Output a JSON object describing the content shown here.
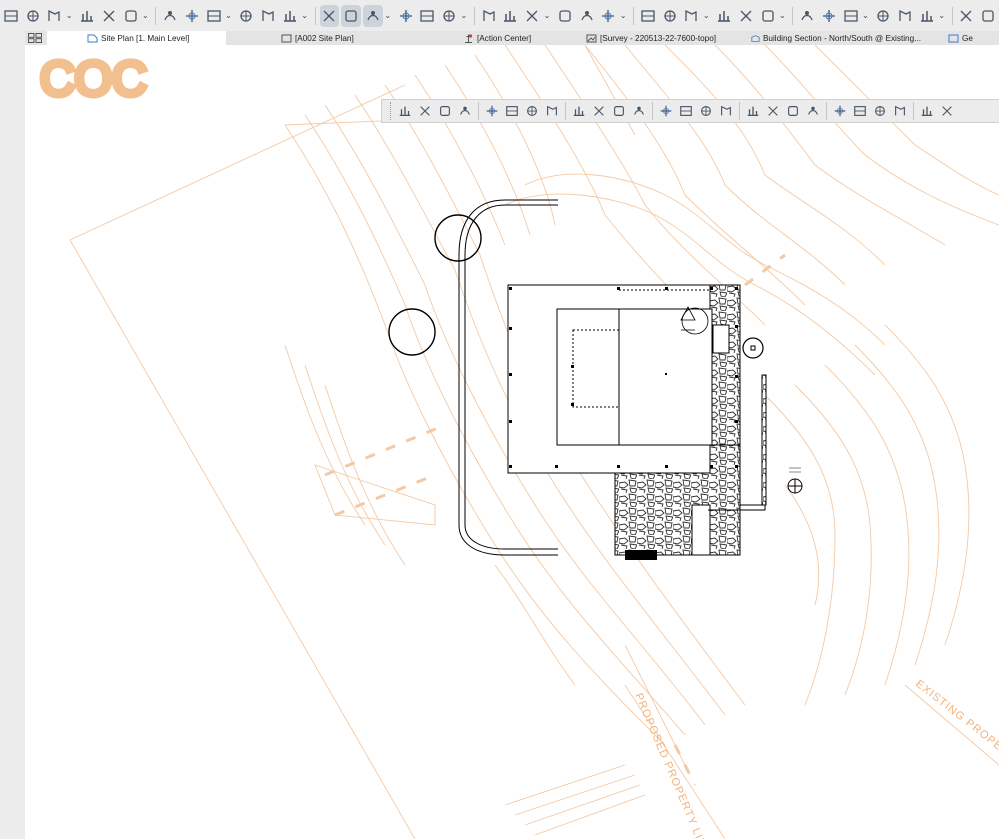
{
  "toolbar": {
    "tools": [
      "floor-plan-icon",
      "3d-window-icon",
      "section-icon",
      "interior-elevation-icon",
      "flag-icon",
      "layer-flag-icon",
      "marquee-icon",
      "fill-icon",
      "chain-icon",
      "view-icon",
      "single-view-icon",
      "suspend-groups-icon",
      "trace-icon",
      "cut-icon",
      "renovation-icon",
      "plug-icon",
      "teamwork-icon",
      "id-icon",
      "align-icon",
      "distribute-icon",
      "eyedropper-icon",
      "curve-icon",
      "elevation-icon",
      "split-icon",
      "offset-icon",
      "trim-icon",
      "adjust-icon",
      "stair-icon",
      "link-icon",
      "level-dim-icon",
      "wall-icon",
      "slab-icon",
      "roof-icon",
      "shell-icon",
      "zone-icon",
      "column-icon",
      "beam-icon",
      "window-icon"
    ]
  },
  "tabs": [
    {
      "label": "Site Plan [1. Main Level]",
      "icon": "floor-plan-icon",
      "active": true
    },
    {
      "label": "[A002 Site Plan]",
      "icon": "layout-icon",
      "active": false
    },
    {
      "label": "[Action Center]",
      "icon": "action-center-icon",
      "active": false
    },
    {
      "label": "[Survey - 220513-22-7600-topo]",
      "icon": "drawing-icon",
      "active": false
    },
    {
      "label": "Building Section - North/South @ Existing...",
      "icon": "section-icon",
      "active": false
    },
    {
      "label": "Ge",
      "icon": "generic-icon",
      "active": false
    }
  ],
  "drawing": {
    "logo_text": "COC",
    "proposed_property_line_label": "PROPOSED PROPERTY LINE",
    "existing_property_line_label": "EXISTING PROPERTY",
    "contour_color": "#f4c9a4",
    "logo_color": "#f2c08f",
    "linework_color": "#000000"
  },
  "floating_toolbar": {
    "tools": [
      "graph-icon",
      "magnify-icon",
      "edit-icon",
      "scissors-icon",
      "resize-icon",
      "stretch-icon",
      "eyedropper-icon",
      "fillet-icon",
      "corner-icon",
      "elevate-icon",
      "rotate-icon",
      "intersect-icon",
      "offset-icon",
      "adjust-icon",
      "split-icon",
      "distribute-icon",
      "align-icon",
      "mirror-icon",
      "group-icon",
      "ungroup-icon",
      "trim-icon",
      "explode-icon",
      "link-icon",
      "house-icon",
      "edit-doc-icon",
      "pencil-doc-icon"
    ]
  }
}
